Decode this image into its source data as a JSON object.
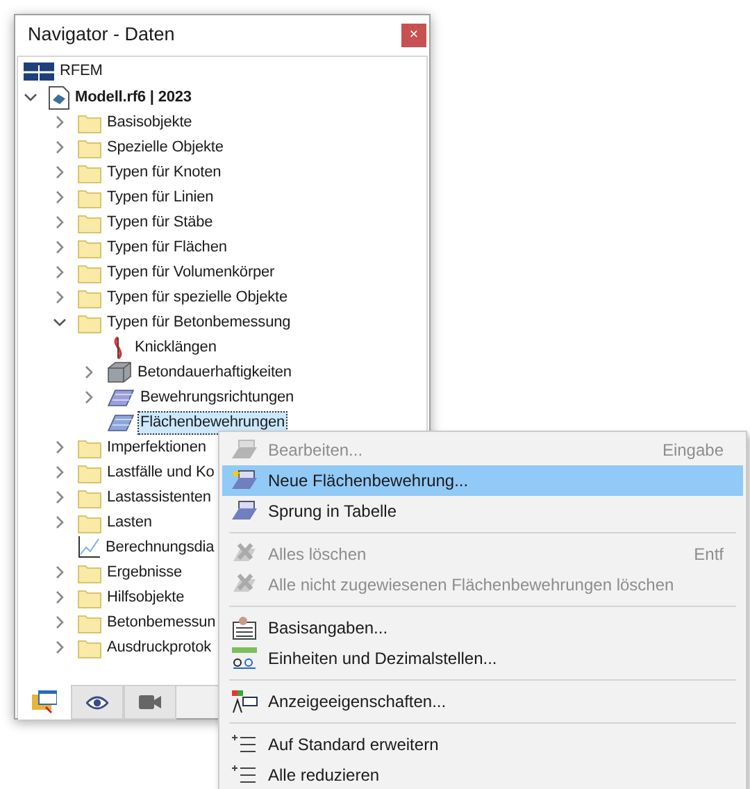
{
  "window": {
    "title": "Navigator - Daten",
    "close": "×"
  },
  "tree": [
    {
      "label": "RFEM",
      "kind": "rfem",
      "selected": false
    },
    {
      "label": "Modell.rf6 | 2023",
      "kind": "model",
      "expanded": true,
      "selected": false,
      "children": [
        {
          "label": "Basisobjekte",
          "kind": "folder",
          "expanded": false,
          "selected": false
        },
        {
          "label": "Spezielle Objekte",
          "kind": "folder",
          "expanded": false,
          "selected": false
        },
        {
          "label": "Typen für Knoten",
          "kind": "folder",
          "expanded": false,
          "selected": false
        },
        {
          "label": "Typen für Linien",
          "kind": "folder",
          "expanded": false,
          "selected": false
        },
        {
          "label": "Typen für Stäbe",
          "kind": "folder",
          "expanded": false,
          "selected": false
        },
        {
          "label": "Typen für Flächen",
          "kind": "folder",
          "expanded": false,
          "selected": false
        },
        {
          "label": "Typen für Volumenkörper",
          "kind": "folder",
          "expanded": false,
          "selected": false
        },
        {
          "label": "Typen für spezielle Objekte",
          "kind": "folder",
          "expanded": false,
          "selected": false
        },
        {
          "label": "Typen für Betonbemessung",
          "kind": "folder",
          "expanded": true,
          "selected": false,
          "children": [
            {
              "label": "Knicklängen",
              "kind": "buckling",
              "selected": false
            },
            {
              "label": "Betondauerhaftigkeiten",
              "kind": "durability",
              "expanded": false,
              "selected": false
            },
            {
              "label": "Bewehrungsrichtungen",
              "kind": "direction",
              "expanded": false,
              "selected": false
            },
            {
              "label": "Flächenbewehrungen",
              "kind": "reinforcement",
              "selected": true
            }
          ]
        },
        {
          "label": "Imperfektionen",
          "kind": "folder",
          "expanded": false,
          "selected": false
        },
        {
          "label": "Lastfälle und Ko",
          "kind": "folder",
          "expanded": false,
          "selected": false
        },
        {
          "label": "Lastassistenten",
          "kind": "folder",
          "expanded": false,
          "selected": false
        },
        {
          "label": "Lasten",
          "kind": "folder",
          "expanded": false,
          "selected": false
        },
        {
          "label": "Berechnungsdia",
          "kind": "diagram",
          "selected": false
        },
        {
          "label": "Ergebnisse",
          "kind": "folder",
          "expanded": false,
          "selected": false
        },
        {
          "label": "Hilfsobjekte",
          "kind": "folder",
          "expanded": false,
          "selected": false
        },
        {
          "label": "Betonbemessun",
          "kind": "folder",
          "expanded": false,
          "selected": false
        },
        {
          "label": "Ausdruckprotok",
          "kind": "folder",
          "expanded": false,
          "selected": false
        }
      ]
    }
  ],
  "bottom_tabs": [
    {
      "kind": "data",
      "selected": true
    },
    {
      "kind": "view",
      "selected": false
    },
    {
      "kind": "camera",
      "selected": false
    }
  ],
  "context_menu": [
    {
      "kind": "item",
      "label": "Bearbeiten...",
      "shortcut": "Eingabe",
      "disabled": true,
      "selected": false
    },
    {
      "kind": "item",
      "label": "Neue Flächenbewehrung...",
      "disabled": false,
      "selected": true
    },
    {
      "kind": "item",
      "label": "Sprung in Tabelle",
      "disabled": false,
      "selected": false
    },
    {
      "kind": "separator"
    },
    {
      "kind": "item",
      "label": "Alles löschen",
      "shortcut": "Entf",
      "disabled": true,
      "selected": false
    },
    {
      "kind": "item",
      "label": "Alle nicht zugewiesenen Flächenbewehrungen löschen",
      "disabled": true,
      "selected": false
    },
    {
      "kind": "separator"
    },
    {
      "kind": "item",
      "label": "Basisangaben...",
      "disabled": false,
      "selected": false
    },
    {
      "kind": "item",
      "label": "Einheiten und Dezimalstellen...",
      "disabled": false,
      "selected": false
    },
    {
      "kind": "separator"
    },
    {
      "kind": "item",
      "label": "Anzeigeeigenschaften...",
      "disabled": false,
      "selected": false
    },
    {
      "kind": "separator"
    },
    {
      "kind": "item",
      "label": "Auf Standard erweitern",
      "disabled": false,
      "selected": false
    },
    {
      "kind": "item",
      "label": "Alle reduzieren",
      "disabled": false,
      "selected": false
    }
  ]
}
